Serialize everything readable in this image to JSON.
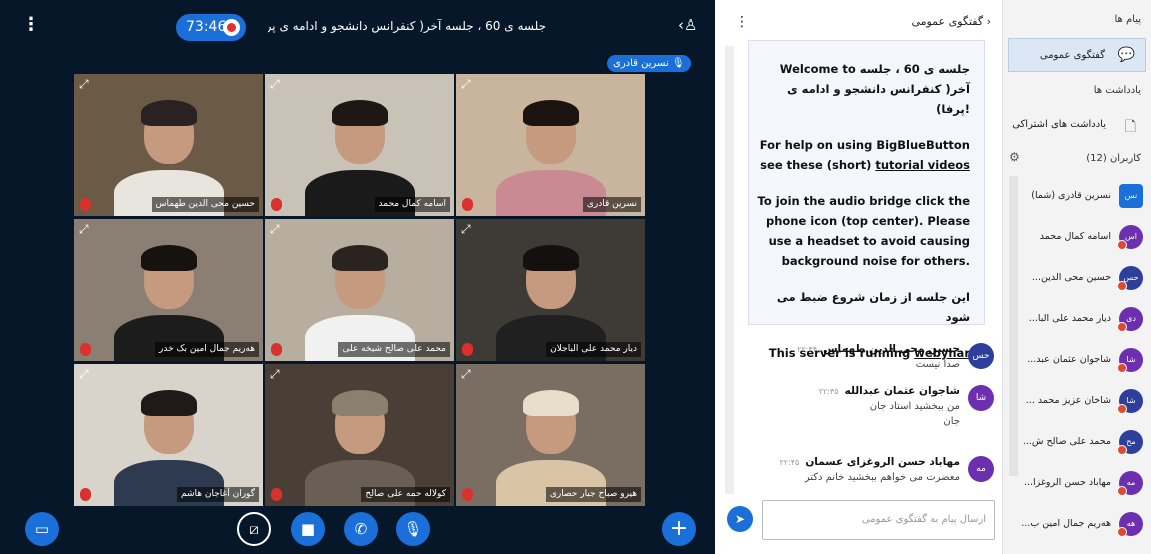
{
  "topbar": {
    "timer": "73:46",
    "title": "جلسه ی 60 ، جلسه آخر( کنفرانس دانشجو و ادامه ی پرفا)",
    "talking": "نسرین قادری"
  },
  "tiles": [
    {
      "name": "حسین محی الدین طهماس",
      "bg": "#6b5a46",
      "body": "#e8e4de",
      "hair": "#2a2222"
    },
    {
      "name": "اسامه کمال محمد",
      "bg": "#c9c2b6",
      "body": "#1a1a1a",
      "hair": "#1d1816"
    },
    {
      "name": "نسرین قادری",
      "bg": "#c9b49d",
      "body": "#c98a93",
      "hair": "#1a1310"
    },
    {
      "name": "هه‌ریم جمال امین بک خدر",
      "bg": "#8a7f72",
      "body": "#1c1c1c",
      "hair": "#161210"
    },
    {
      "name": "محمد علی صالح شیخه علی",
      "bg": "#b8ae9f",
      "body": "#f1f1f1",
      "hair": "#2b2320"
    },
    {
      "name": "دیار محمد علی الباجلان",
      "bg": "#3e3a36",
      "body": "#202020",
      "hair": "#151010"
    },
    {
      "name": "گوران آغاجان هاشم",
      "bg": "#d9d4cb",
      "body": "#2d3a50",
      "hair": "#1f1a18"
    },
    {
      "name": "کولاله حمه علی صالح",
      "bg": "#4a3f36",
      "body": "#6a5f55",
      "hair": "#8a8070"
    },
    {
      "name": "هیرو صباح جبار حصاری",
      "bg": "#7a6e62",
      "body": "#d9c4a5",
      "hair": "#e8dccb"
    }
  ],
  "chat": {
    "header": "گفتگوی عمومی",
    "welcome": {
      "l1": "Welcome to جلسه ی 60 ، جلسه آخر( کنفرانس دانشجو و ادامه ی پرفا)!",
      "l2a": "For help on using BigBlueButton see these (short) ",
      "l2link": "tutorial videos",
      "l3": "To join the audio bridge click the phone icon (top center). Please use a headset to avoid causing background noise for others.",
      "l4": "این جلسه از زمان شروع ضبط می شود",
      "l5a": "This server is running ",
      "l5link": "webynar"
    },
    "messages": [
      {
        "initials": "حس",
        "color": "#2d3e9b",
        "name": "حسین محی الدین طهماس",
        "time": "۲۲:۴۴",
        "lines": [
          "صدا نیست"
        ]
      },
      {
        "initials": "شا",
        "color": "#6b2fb0",
        "name": "شاجوان عثمان عبدالله",
        "time": "۲۲:۴۵",
        "lines": [
          "من ببخشید استاد جان",
          "جان"
        ]
      },
      {
        "initials": "مه",
        "color": "#6b2fb0",
        "name": "مهاباد حسن الروغزای عسمان",
        "time": "۲۲:۴۵",
        "lines": [
          "معضرت می خواهم ببخشید خانم دکتر"
        ]
      }
    ],
    "input_placeholder": "ارسال پیام به گفتگوی عمومی"
  },
  "side": {
    "messages_header": "پیام ها",
    "public_chat": "گفتگوی عمومی",
    "notes_header": "یادداشت ها",
    "shared_notes": "یادداشت های اشتراکی",
    "users_header": "کاربران (12)",
    "users": [
      {
        "initials": "نس",
        "color": "#1b6fd8",
        "name": "نسرین قادری (شما)",
        "me": true
      },
      {
        "initials": "اس",
        "color": "#6b2fb0",
        "name": "اسامه کمال محمد"
      },
      {
        "initials": "حس",
        "color": "#2d3e9b",
        "name": "حسین محی الدین..."
      },
      {
        "initials": "دی",
        "color": "#6b2fb0",
        "name": "دیار محمد علی البا..."
      },
      {
        "initials": "شا",
        "color": "#6b2fb0",
        "name": "شاجوان عثمان عبد..."
      },
      {
        "initials": "شا",
        "color": "#2d3e9b",
        "name": "شاخان عزیز محمد ..."
      },
      {
        "initials": "مح",
        "color": "#2d3e9b",
        "name": "محمد علی صالح ش..."
      },
      {
        "initials": "مه",
        "color": "#6b2fb0",
        "name": "مهاباد حسن الروغزا..."
      },
      {
        "initials": "هه",
        "color": "#6b2fb0",
        "name": "هه‌ریم جمال امین ب..."
      }
    ]
  }
}
